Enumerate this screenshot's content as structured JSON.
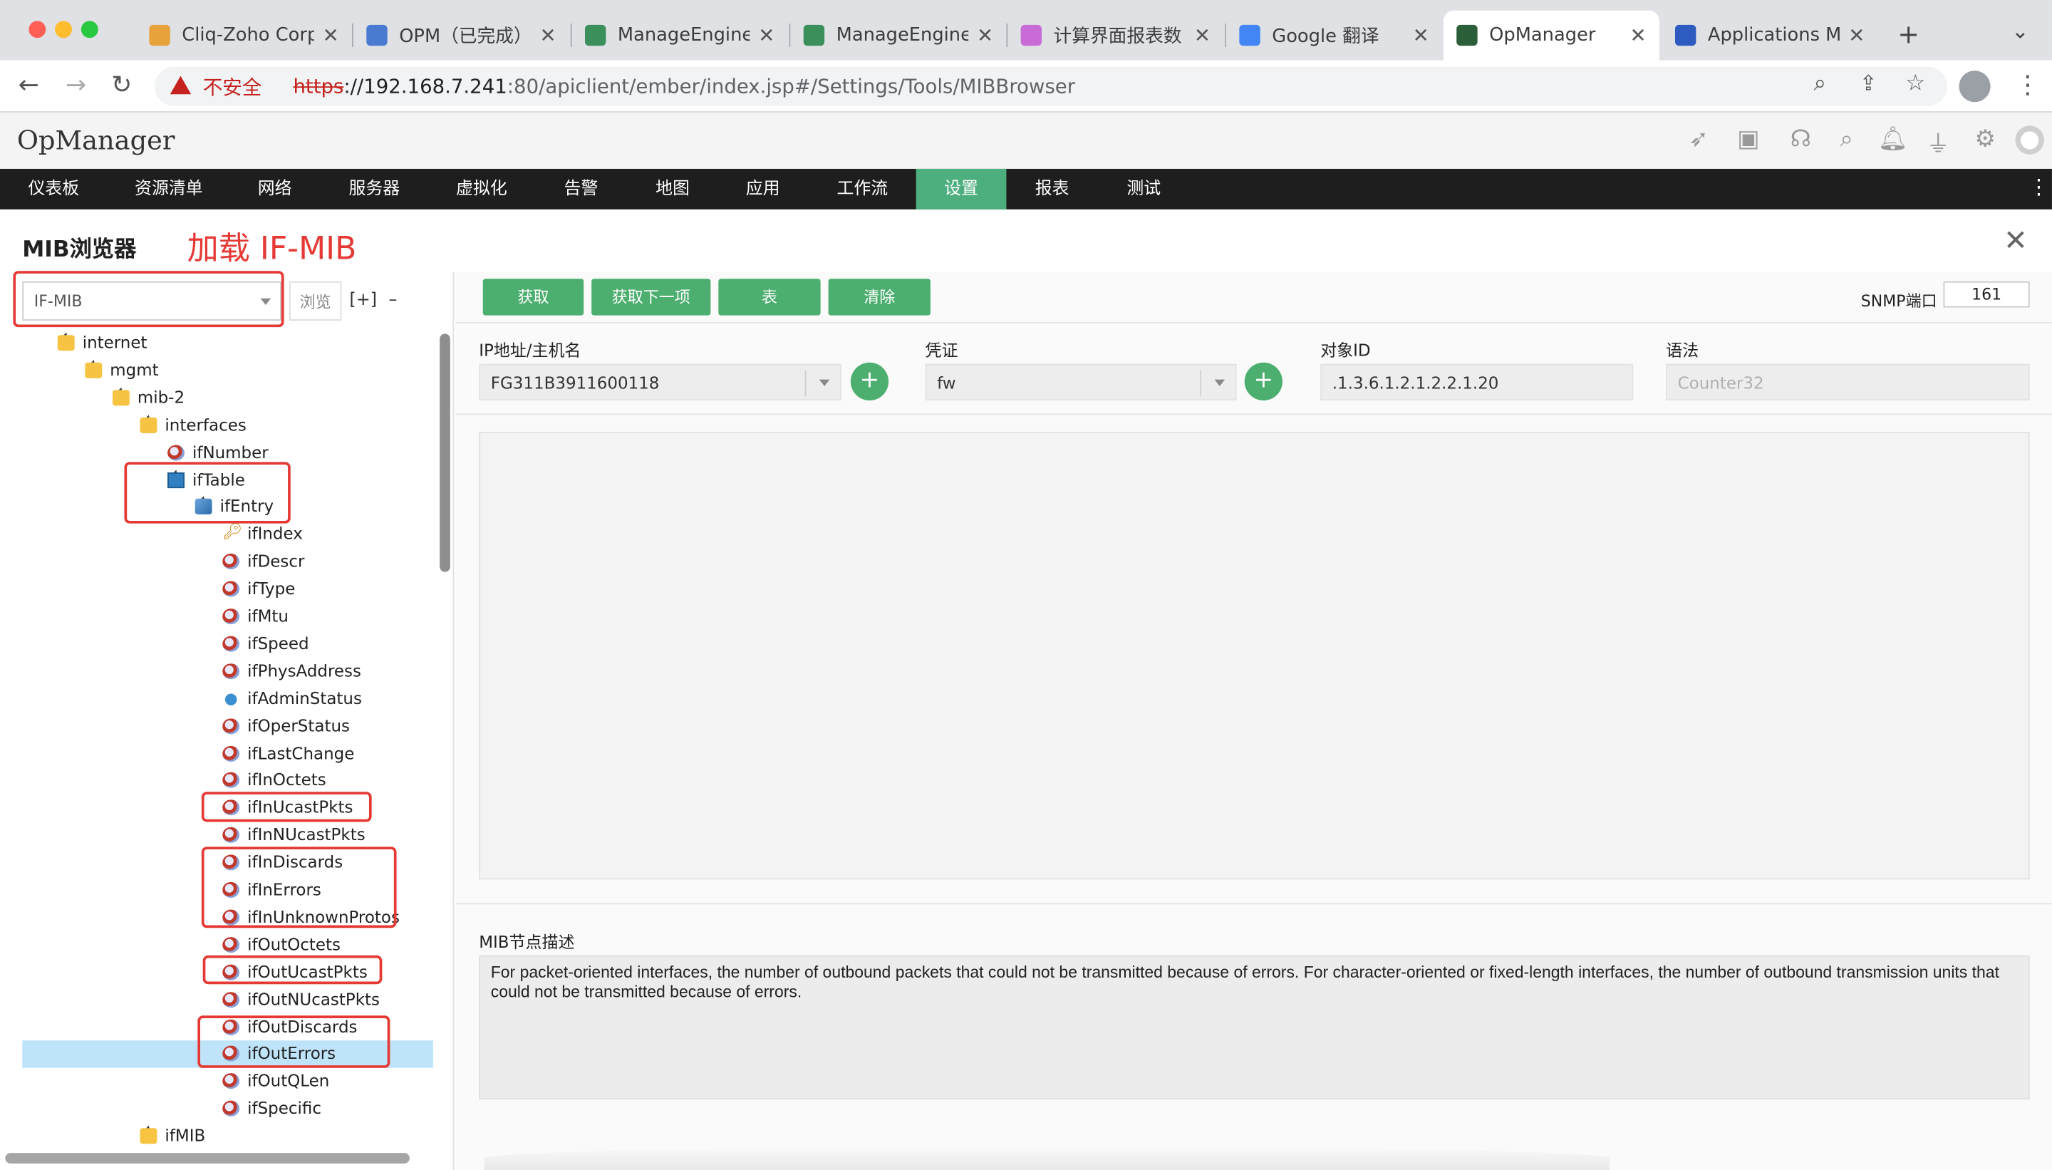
{
  "browser": {
    "tabs": [
      {
        "title": "Cliq-Zoho Corp",
        "fav_color": "#e7a23b"
      },
      {
        "title": "OPM（已完成）",
        "fav_color": "#4a7bd0"
      },
      {
        "title": "ManageEngine",
        "fav_color": "#3a8f5a"
      },
      {
        "title": "ManageEngine",
        "fav_color": "#3a8f5a"
      },
      {
        "title": "计算界面报表数",
        "fav_color": "#c96bd6"
      },
      {
        "title": "Google 翻译",
        "fav_color": "#4285f4"
      },
      {
        "title": "OpManager",
        "fav_color": "#2b5f3a"
      },
      {
        "title": "Applications Ma",
        "fav_color": "#2d5bbf"
      }
    ],
    "active_tab_index": 6,
    "tab_close": "✕",
    "new_tab": "+",
    "insecure_label": "不安全",
    "url_scheme": "https",
    "url_host": "://192.168.7.241",
    "url_rest": ":80/apiclient/ember/index.jsp#/Settings/Tools/MIBBrowser"
  },
  "app": {
    "title": "OpManager",
    "header_icons": [
      "rocket-icon",
      "screen-icon",
      "headset-icon",
      "search-icon",
      "bell-icon",
      "plug-icon",
      "gear-icon",
      "user-icon"
    ],
    "menu": [
      "仪表板",
      "资源清单",
      "网络",
      "服务器",
      "虚拟化",
      "告警",
      "地图",
      "应用",
      "工作流",
      "设置",
      "报表",
      "测试"
    ],
    "menu_active": "设置"
  },
  "page": {
    "title": "MIB浏览器",
    "annotation": "加载 IF-MIB",
    "close": "✕"
  },
  "mib": {
    "selected": "IF-MIB",
    "browse": "浏览",
    "expand": "[+]",
    "collapse": "–"
  },
  "tree": [
    {
      "label": "internet",
      "depth": 0,
      "icon": "folder",
      "expanded": true
    },
    {
      "label": "mgmt",
      "depth": 1,
      "icon": "folder",
      "expanded": true
    },
    {
      "label": "mib-2",
      "depth": 2,
      "icon": "folder",
      "expanded": true
    },
    {
      "label": "interfaces",
      "depth": 3,
      "icon": "folder",
      "expanded": true
    },
    {
      "label": "ifNumber",
      "depth": 4,
      "icon": "leaf"
    },
    {
      "label": "ifTable",
      "depth": 4,
      "icon": "table",
      "expanded": true
    },
    {
      "label": "ifEntry",
      "depth": 5,
      "icon": "entry",
      "expanded": true
    },
    {
      "label": "ifIndex",
      "depth": 6,
      "icon": "key"
    },
    {
      "label": "ifDescr",
      "depth": 6,
      "icon": "leaf"
    },
    {
      "label": "ifType",
      "depth": 6,
      "icon": "leaf"
    },
    {
      "label": "ifMtu",
      "depth": 6,
      "icon": "leaf"
    },
    {
      "label": "ifSpeed",
      "depth": 6,
      "icon": "leaf"
    },
    {
      "label": "ifPhysAddress",
      "depth": 6,
      "icon": "leaf"
    },
    {
      "label": "ifAdminStatus",
      "depth": 6,
      "icon": "dot"
    },
    {
      "label": "ifOperStatus",
      "depth": 6,
      "icon": "leaf"
    },
    {
      "label": "ifLastChange",
      "depth": 6,
      "icon": "leaf"
    },
    {
      "label": "ifInOctets",
      "depth": 6,
      "icon": "leaf"
    },
    {
      "label": "ifInUcastPkts",
      "depth": 6,
      "icon": "leaf"
    },
    {
      "label": "ifInNUcastPkts",
      "depth": 6,
      "icon": "leaf"
    },
    {
      "label": "ifInDiscards",
      "depth": 6,
      "icon": "leaf"
    },
    {
      "label": "ifInErrors",
      "depth": 6,
      "icon": "leaf"
    },
    {
      "label": "ifInUnknownProtos",
      "depth": 6,
      "icon": "leaf"
    },
    {
      "label": "ifOutOctets",
      "depth": 6,
      "icon": "leaf"
    },
    {
      "label": "ifOutUcastPkts",
      "depth": 6,
      "icon": "leaf"
    },
    {
      "label": "ifOutNUcastPkts",
      "depth": 6,
      "icon": "leaf"
    },
    {
      "label": "ifOutDiscards",
      "depth": 6,
      "icon": "leaf"
    },
    {
      "label": "ifOutErrors",
      "depth": 6,
      "icon": "leaf",
      "selected": true
    },
    {
      "label": "ifOutQLen",
      "depth": 6,
      "icon": "leaf"
    },
    {
      "label": "ifSpecific",
      "depth": 6,
      "icon": "leaf"
    },
    {
      "label": "ifMIB",
      "depth": 3,
      "icon": "folder",
      "expanded": true
    }
  ],
  "toolbar": {
    "get": "获取",
    "get_next": "获取下一项",
    "table": "表",
    "clear": "清除",
    "snmp_port_label": "SNMP端口",
    "snmp_port": "161"
  },
  "form": {
    "ip_label": "IP地址/主机名",
    "ip_value": "FG311B3911600118",
    "cred_label": "凭证",
    "cred_value": "fw",
    "oid_label": "对象ID",
    "oid_value": ".1.3.6.1.2.1.2.2.1.20",
    "syntax_label": "语法",
    "syntax_value": "Counter32",
    "add": "+"
  },
  "description": {
    "label": "MIB节点描述",
    "text": "For packet-oriented interfaces, the number of outbound packets that could not be transmitted because of errors. For character-oriented or fixed-length interfaces, the number of outbound transmission units that could not be transmitted because of errors."
  },
  "colors": {
    "accent_green": "#4cae6f",
    "menu_active": "#4caf7d",
    "annotation_red": "#e53935",
    "selection_blue": "#bfe4fa"
  }
}
